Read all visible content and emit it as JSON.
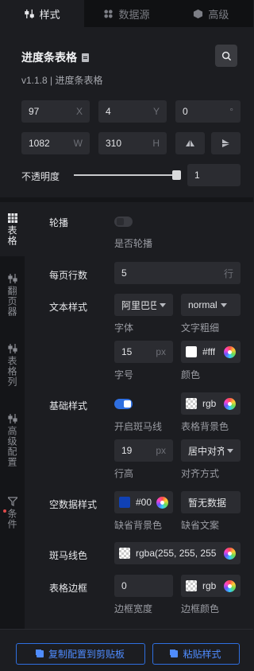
{
  "tabs": [
    {
      "label": "样式",
      "icon": "style-icon"
    },
    {
      "label": "数据源",
      "icon": "datasource-icon"
    },
    {
      "label": "高级",
      "icon": "advanced-icon"
    }
  ],
  "header": {
    "title": "进度条表格",
    "version": "v1.1.8 | 进度条表格"
  },
  "position": {
    "x": "97",
    "x_suffix": "X",
    "y": "4",
    "y_suffix": "Y",
    "rotation": "0",
    "rotation_suffix": "°",
    "width": "1082",
    "width_suffix": "W",
    "height": "310",
    "height_suffix": "H"
  },
  "opacity": {
    "label": "不透明度",
    "value": "1",
    "level": 1
  },
  "sidenav": [
    {
      "label": "表格"
    },
    {
      "label": "翻页器"
    },
    {
      "label": "表格列"
    },
    {
      "label": "高级配置"
    },
    {
      "label": "条件"
    }
  ],
  "settings": {
    "carousel": {
      "label": "轮播",
      "sub": "是否轮播",
      "enabled": false
    },
    "rows_per_page": {
      "label": "每页行数",
      "value": "5",
      "unit": "行"
    },
    "text_style": {
      "label": "文本样式",
      "font": "阿里巴巴",
      "font_sub": "字体",
      "weight": "normal",
      "weight_sub": "文字粗细",
      "size": "15",
      "size_unit": "px",
      "size_sub": "字号",
      "color": "#fff",
      "color_sub": "颜色"
    },
    "base_style": {
      "label": "基础样式",
      "zebra_sub": "开启斑马线",
      "zebra_enabled": true,
      "bg": "rgb",
      "bg_sub": "表格背景色",
      "row_height": "19",
      "row_height_unit": "px",
      "row_height_sub": "行高",
      "align": "居中对齐",
      "align_sub": "对齐方式"
    },
    "empty_style": {
      "label": "空数据样式",
      "bg": "#00",
      "bg_color": "#1041b5",
      "bg_sub": "缺省背景色",
      "text": "暂无数据",
      "text_sub": "缺省文案"
    },
    "zebra_color": {
      "label": "斑马线色",
      "value": "rgba(255, 255, 255"
    },
    "border": {
      "label": "表格边框",
      "width": "0",
      "width_sub": "边框宽度",
      "color": "rgb",
      "color_sub": "边框颜色"
    }
  },
  "footer": {
    "copy_label": "复制配置到剪贴板",
    "paste_label": "粘贴样式"
  },
  "colors": {
    "accent": "#2f6fe0",
    "background": "#1c1d21",
    "field": "#2b2c31"
  }
}
